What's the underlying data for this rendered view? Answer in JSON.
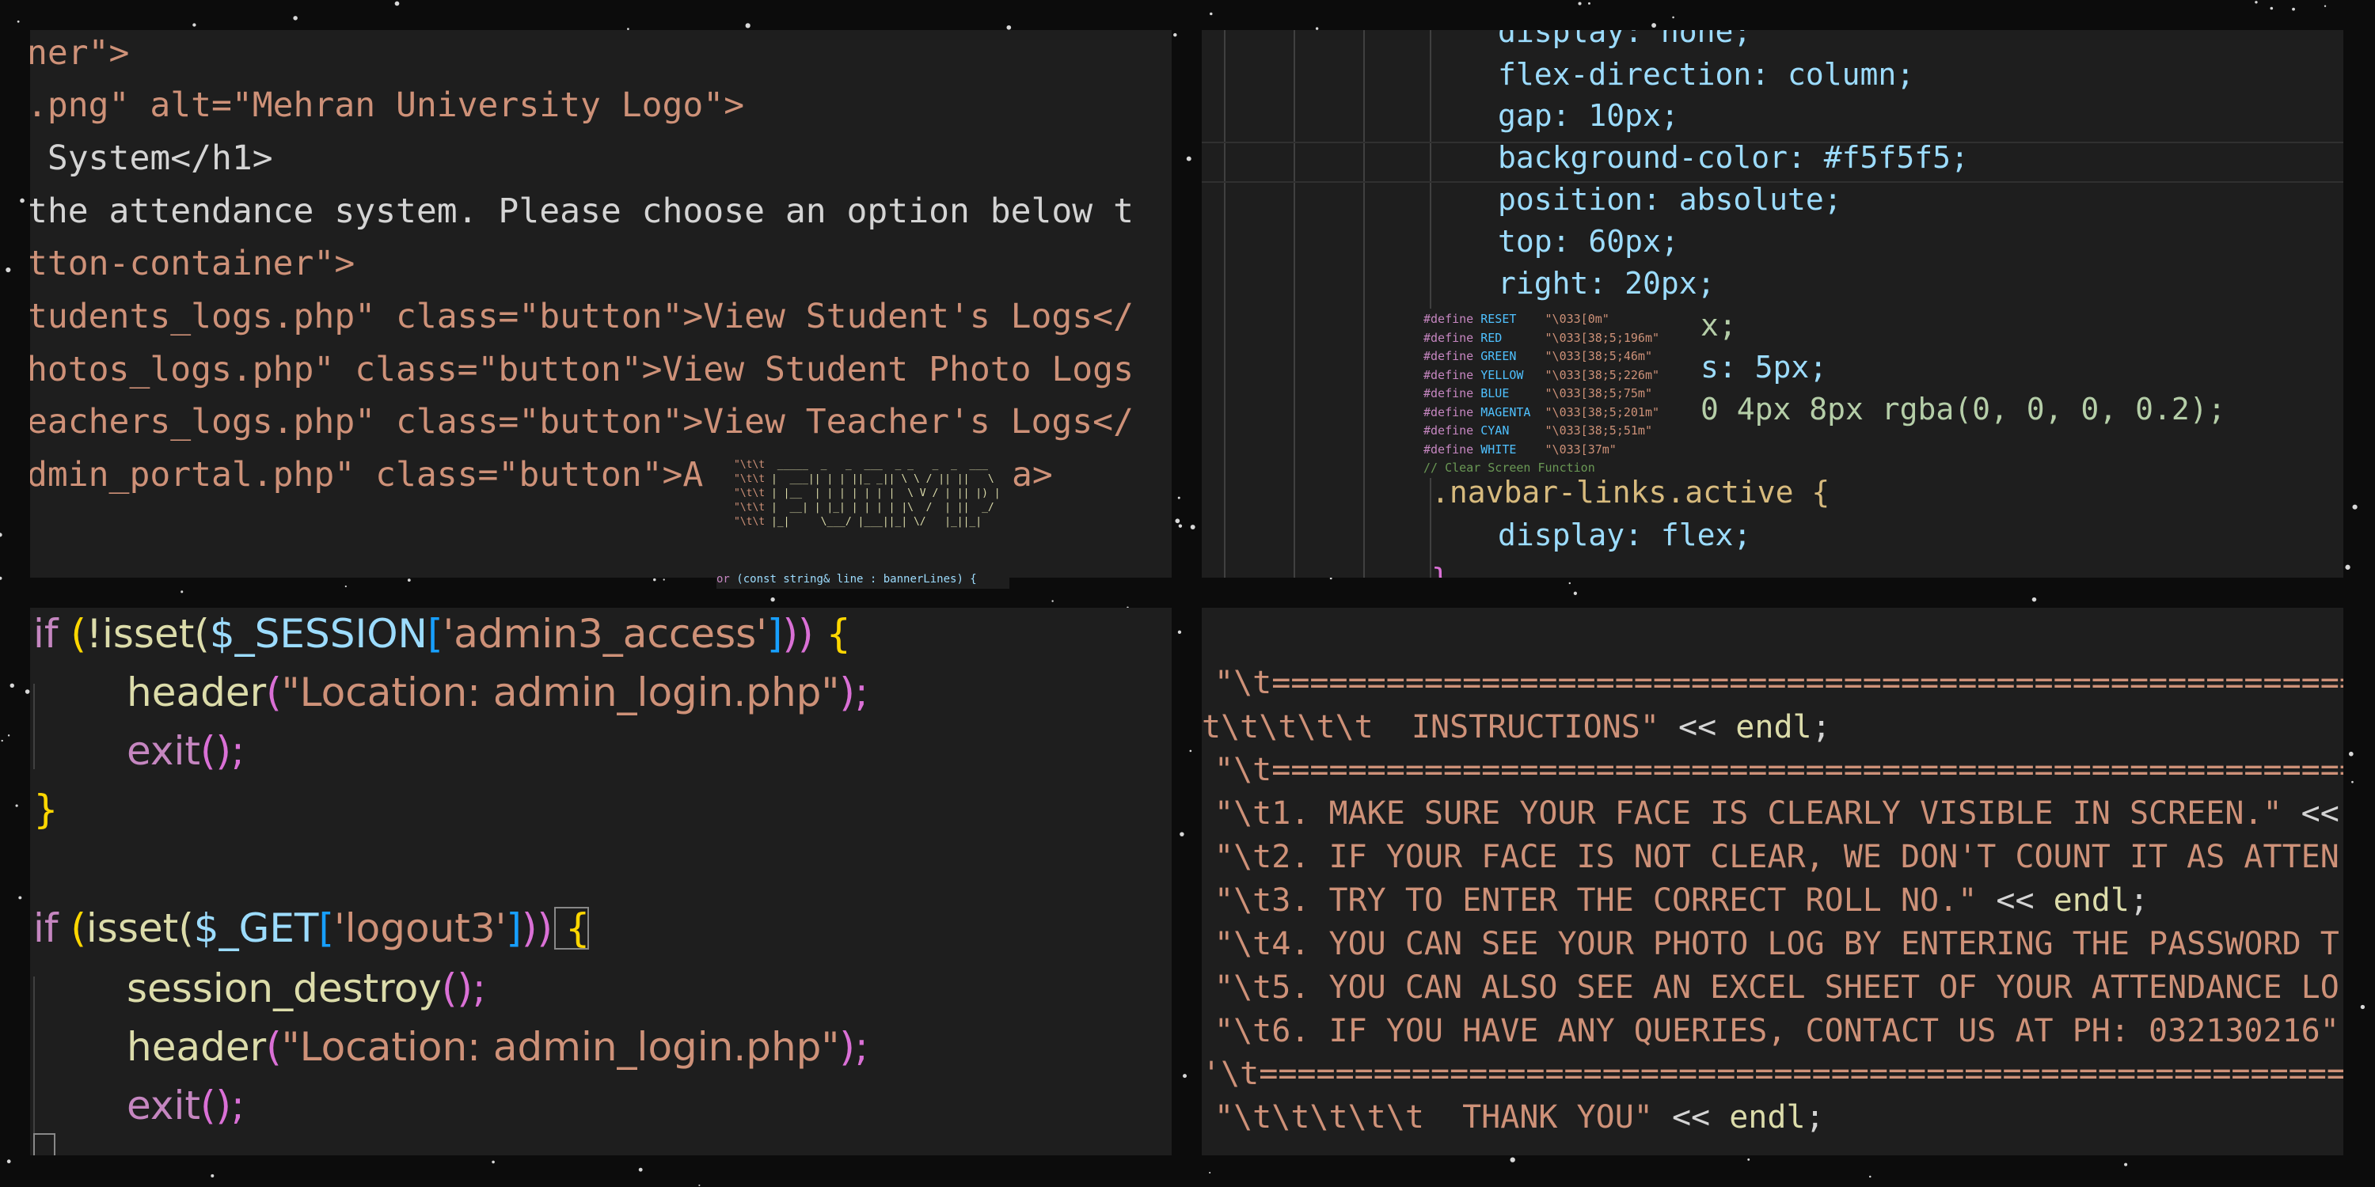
{
  "collage": {
    "html_panel": {
      "lines": [
        "ner\">",
        ".png\" alt=\"Mehran University Logo\">",
        " System</h1>",
        "the attendance system. Please choose an option below t",
        "tton-container\">",
        "tudents_logs.php\" class=\"button\">View Student's Logs</",
        "hotos_logs.php\" class=\"button\">View Student Photo Logs",
        "eachers_logs.php\" class=\"button\">View Teacher's Logs</",
        "dmin_portal.php\" class=\"button\">A"
      ],
      "link_tail": "a>"
    },
    "css_panel": {
      "lines": [
        "display: none;",
        "flex-direction: column;",
        "gap: 10px;",
        "background-color: #f5f5f5;",
        "position: absolute;",
        "top: 60px;",
        "right: 20px;",
        "x;",
        "s: 5px;",
        "0 4px 8px rgba(0, 0, 0, 0.2);",
        ".navbar-links.active {",
        "display: flex;",
        "}"
      ]
    },
    "define_overlay": {
      "keyword": "#define",
      "items": [
        {
          "name": "RESET",
          "value": "\"\\033[0m\""
        },
        {
          "name": "RED",
          "value": "\"\\033[38;5;196m\""
        },
        {
          "name": "GREEN",
          "value": "\"\\033[38;5;46m\""
        },
        {
          "name": "YELLOW",
          "value": "\"\\033[38;5;226m\""
        },
        {
          "name": "BLUE",
          "value": "\"\\033[38;5;75m\""
        },
        {
          "name": "MAGENTA",
          "value": "\"\\033[38;5;201m\""
        },
        {
          "name": "CYAN",
          "value": "\"\\033[38;5;51m\""
        },
        {
          "name": "WHITE",
          "value": "\"\\033[37m\""
        }
      ],
      "trailing_comment": "// Clear Screen Function"
    },
    "banner_overlay": {
      "prefix": "\"\\t\\t",
      "art_rows": [
        " _____  _   _  ___  _ _   _  _  ___ ",
        "|  ___|| | | ||_ _|| \\ \\ / || ||   \\",
        "| |__  | | | | | | |  \\ V / | || |) |",
        "|  __| | |_| | | | | |\\  /  | ||  _/ ",
        "|_|     \\___/ |___||_| \\/   |_||_|   "
      ],
      "loop_line": "or (const string& line : bannerLines) {"
    },
    "php_panel": {
      "line1": [
        "if",
        " (",
        "!isset(",
        "$_SESSION",
        "[",
        "'admin3_access'",
        "]",
        "))",
        " {"
      ],
      "line2": [
        "header",
        "(",
        "\"Location: admin_login.php\"",
        ");"
      ],
      "line3": [
        "exit",
        "();"
      ],
      "line4": "}",
      "line5": [
        "if",
        " (",
        "isset(",
        "$_GET",
        "[",
        "'logout3'",
        "]",
        "))",
        " {"
      ],
      "line6": [
        "session_destroy",
        "();"
      ],
      "line7": [
        "header",
        "(",
        "\"Location: admin_login.php\"",
        ");"
      ],
      "line8": [
        "exit",
        "();"
      ]
    },
    "cpp_panel": {
      "lines": [
        {
          "q": "\"\\t=============================================================",
          "op": ""
        },
        {
          "q": "t\\t\\t\\t\\t  INSTRUCTIONS\"",
          "op": " << ",
          "fn": "endl",
          "end": ";"
        },
        {
          "q": "\"\\t=============================================================",
          "op": ""
        },
        {
          "q": "\"\\t1. MAKE SURE YOUR FACE IS CLEARLY VISIBLE IN SCREEN.\"",
          "op": " <<",
          "fn": "",
          "end": ""
        },
        {
          "q": "\"\\t2. IF YOUR FACE IS NOT CLEAR, WE DON'T COUNT IT AS ATTEN",
          "op": ""
        },
        {
          "q": "\"\\t3. TRY TO ENTER THE CORRECT ROLL NO.\"",
          "op": " << ",
          "fn": "endl",
          "end": ";"
        },
        {
          "q": "\"\\t4. YOU CAN SEE YOUR PHOTO LOG BY ENTERING THE PASSWORD T",
          "op": ""
        },
        {
          "q": "\"\\t5. YOU CAN ALSO SEE AN EXCEL SHEET OF YOUR ATTENDANCE LO",
          "op": ""
        },
        {
          "q": "\"\\t6. IF YOU HAVE ANY QUERIES, CONTACT US AT PH: 032130216\"",
          "op": ""
        },
        {
          "q": "'\\t=============================================================",
          "op": ""
        },
        {
          "q": "\"\\t\\t\\t\\t\\t  THANK YOU\"",
          "op": " << ",
          "fn": "endl",
          "end": ";"
        }
      ]
    },
    "colors": {
      "background": "#0c0c0c",
      "editor": "#1e1e1e",
      "string": "#ce9178",
      "keyword": "#c586c0",
      "variable": "#9cdcfe",
      "function": "#dcdcaa"
    }
  }
}
